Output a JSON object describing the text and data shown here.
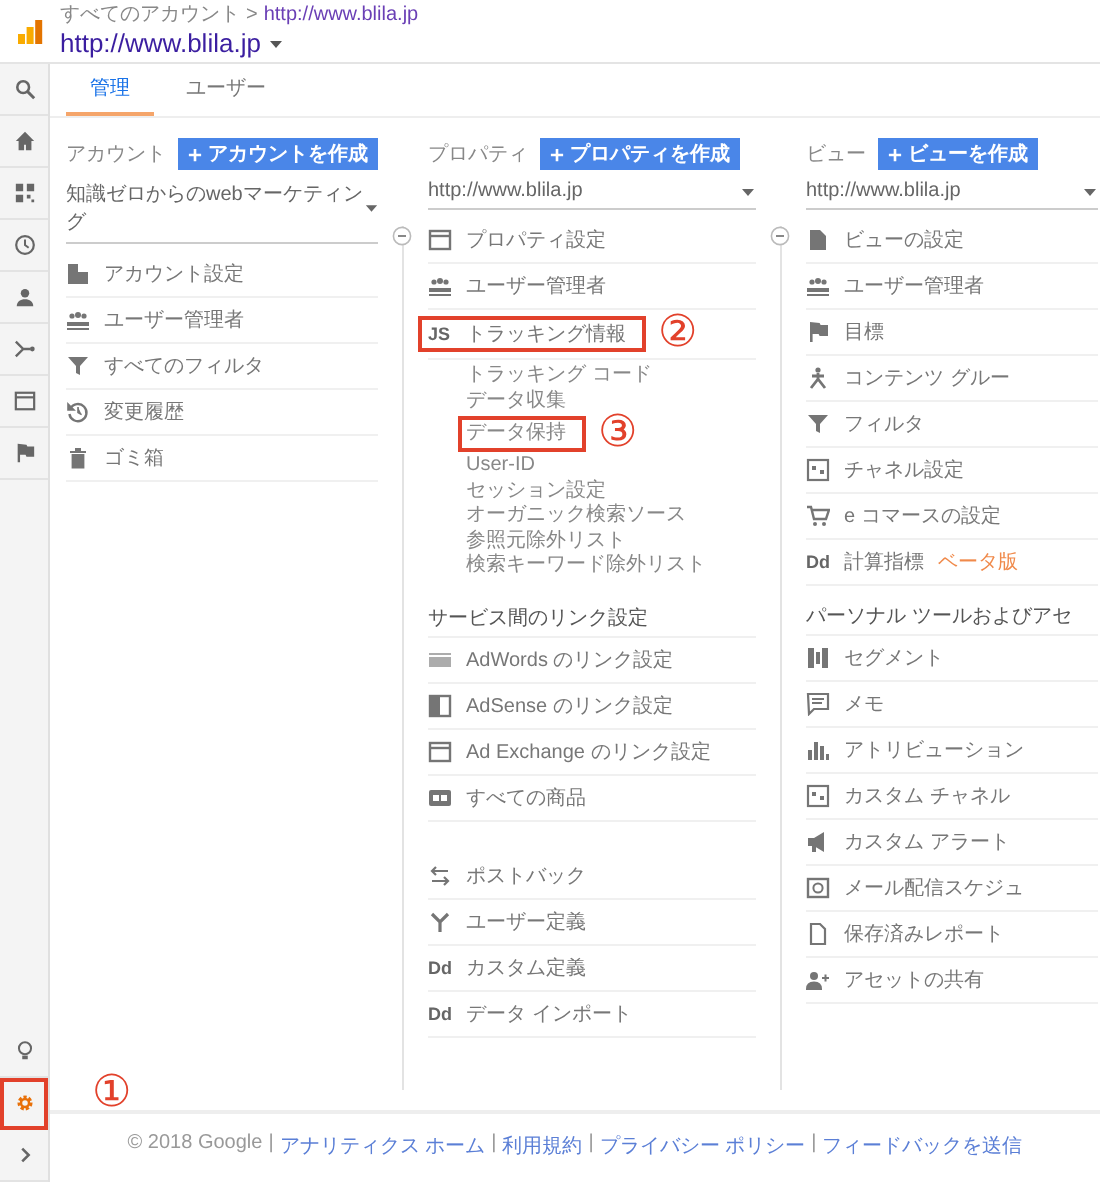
{
  "header": {
    "breadcrumb": {
      "root": "すべてのアカウント",
      "separator": ">",
      "current": "http://www.blila.jp"
    },
    "title": "http://www.blila.jp"
  },
  "sidebar": {
    "items": [
      {
        "kind": "search",
        "selected": false
      },
      {
        "kind": "home",
        "selected": false
      },
      {
        "kind": "dashboard",
        "selected": false
      },
      {
        "kind": "clock",
        "selected": false
      },
      {
        "kind": "person",
        "selected": false
      },
      {
        "kind": "fork",
        "selected": false
      },
      {
        "kind": "window",
        "selected": false
      },
      {
        "kind": "flag",
        "selected": false
      }
    ],
    "bottom_items": [
      {
        "kind": "bulb",
        "selected": false
      },
      {
        "kind": "gear",
        "selected": true,
        "annotation": "①"
      },
      {
        "kind": "chevron",
        "selected": false
      }
    ]
  },
  "tabs": [
    {
      "label": "管理",
      "selected": true
    },
    {
      "label": "ユーザー",
      "selected": false
    }
  ],
  "columns": [
    {
      "label": "アカウント",
      "create_button": "アカウントを作成",
      "selector": "知識ゼロからのwebマーケティング",
      "sections": [
        {
          "items": [
            {
              "kind": "building",
              "label": "アカウント設定"
            },
            {
              "kind": "users",
              "label": "ユーザー管理者"
            },
            {
              "kind": "filter",
              "label": "すべてのフィルタ"
            },
            {
              "kind": "history",
              "label": "変更履歴"
            },
            {
              "kind": "trash",
              "label": "ゴミ箱"
            }
          ]
        }
      ]
    },
    {
      "label": "プロパティ",
      "create_button": "プロパティを作成",
      "selector": "http://www.blila.jp",
      "sections": [
        {
          "items": [
            {
              "kind": "window",
              "label": "プロパティ設定"
            },
            {
              "kind": "users",
              "label": "ユーザー管理者"
            },
            {
              "icon_text": "JS",
              "label": "トラッキング情報",
              "annotation": "②",
              "children": [
                {
                  "label": "トラッキング コード"
                },
                {
                  "label": "データ収集"
                },
                {
                  "label": "データ保持",
                  "annotation": "③"
                },
                {
                  "label": "User-ID"
                },
                {
                  "label": "セッション設定"
                },
                {
                  "label": "オーガニック検索ソース"
                },
                {
                  "label": "参照元除外リスト"
                },
                {
                  "label": "検索キーワード除外リスト"
                }
              ]
            }
          ]
        },
        {
          "heading": "サービス間のリンク設定",
          "items": [
            {
              "kind": "card",
              "label": "AdWords のリンク設定"
            },
            {
              "kind": "half-square",
              "label": "AdSense のリンク設定"
            },
            {
              "kind": "window",
              "label": "Ad Exchange のリンク設定"
            },
            {
              "kind": "tile",
              "label": "すべての商品"
            }
          ]
        },
        {
          "items": [
            {
              "kind": "arrows",
              "label": "ポストバック"
            },
            {
              "kind": "y-fork",
              "label": "ユーザー定義"
            },
            {
              "icon_text": "Dd",
              "label": "カスタム定義"
            },
            {
              "icon_text": "Dd",
              "label": "データ インポート"
            }
          ]
        }
      ]
    },
    {
      "label": "ビュー",
      "create_button": "ビューを作成",
      "selector": "http://www.blila.jp",
      "sections": [
        {
          "items": [
            {
              "kind": "doc",
              "label": "ビューの設定"
            },
            {
              "kind": "users",
              "label": "ユーザー管理者"
            },
            {
              "kind": "flag",
              "label": "目標"
            },
            {
              "kind": "person-branch",
              "label": "コンテンツ グルー"
            },
            {
              "kind": "filter",
              "label": "フィルタ"
            },
            {
              "kind": "channel",
              "label": "チャネル設定"
            },
            {
              "kind": "cart",
              "label": "e コマースの設定"
            },
            {
              "icon_text": "Dd",
              "label": "計算指標",
              "badge": "ベータ版"
            }
          ]
        },
        {
          "heading": "パーソナル ツールおよびアセ",
          "items": [
            {
              "kind": "segment",
              "label": "セグメント"
            },
            {
              "kind": "note",
              "label": "メモ"
            },
            {
              "kind": "bars",
              "label": "アトリビューション"
            },
            {
              "kind": "channel",
              "label": "カスタム チャネル"
            },
            {
              "kind": "megaphone",
              "label": "カスタム アラート"
            },
            {
              "kind": "alarm",
              "label": "メール配信スケジュ"
            },
            {
              "kind": "page",
              "label": "保存済みレポート"
            },
            {
              "kind": "person-add",
              "label": "アセットの共有"
            }
          ]
        }
      ]
    }
  ],
  "footer": [
    {
      "kind": "text",
      "label": "© 2018 Google"
    },
    {
      "kind": "separator",
      "label": "|"
    },
    {
      "kind": "link",
      "label": "アナリティクス ホーム"
    },
    {
      "kind": "separator",
      "label": "|"
    },
    {
      "kind": "link",
      "label": "利用規約"
    },
    {
      "kind": "separator",
      "label": "|"
    },
    {
      "kind": "link",
      "label": "プライバシー ポリシー"
    },
    {
      "kind": "separator",
      "label": "|"
    },
    {
      "kind": "link",
      "label": "フィードバックを送信"
    }
  ]
}
